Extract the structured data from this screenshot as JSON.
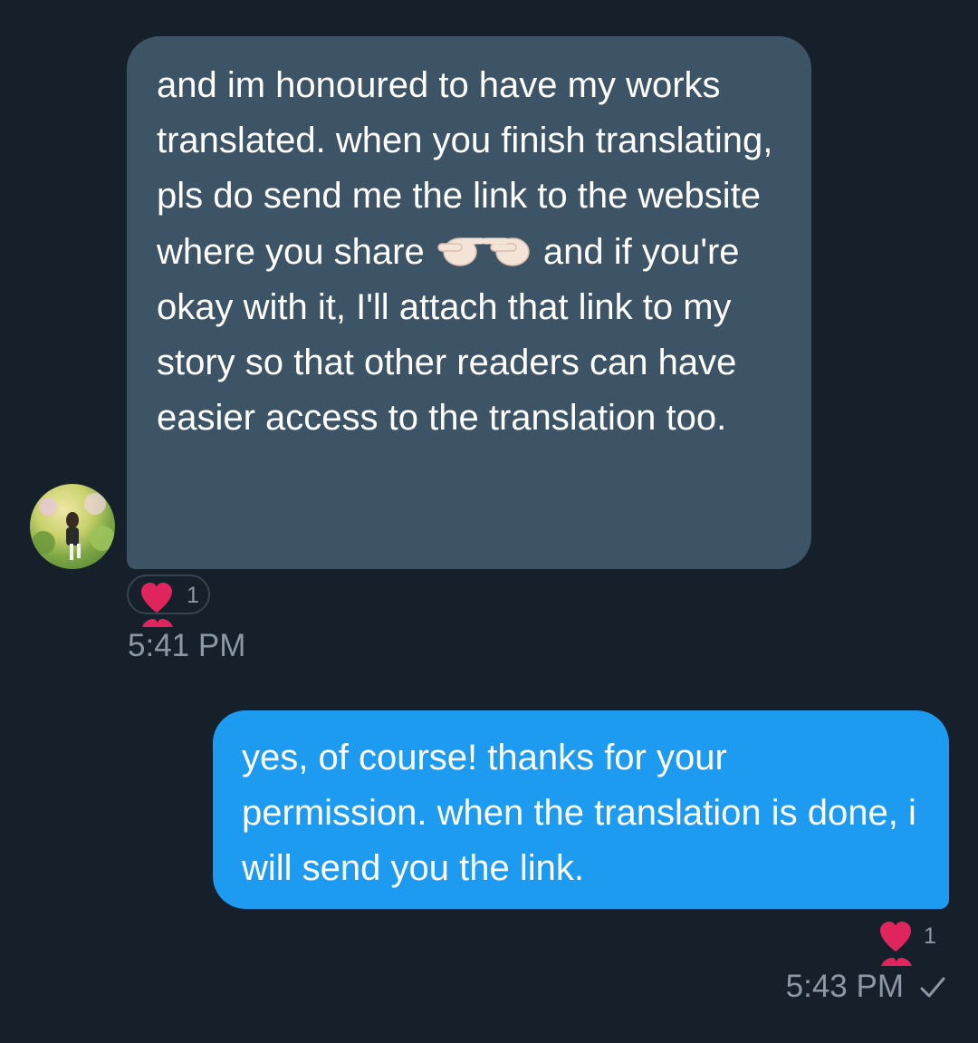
{
  "messages": {
    "incoming": {
      "text_before_emoji": "and im honoured to have my works translated. when you finish translating, pls do send me the link to the website where you share",
      "emoji": "👉👈",
      "text_after_emoji": "and if you're okay with it, I'll attach that link to my story so that other readers can have easier access to the translation too.",
      "reaction_count": "1",
      "timestamp": "5:41 PM"
    },
    "outgoing": {
      "text": "yes, of course! thanks for your permission. when the translation is done, i will send you the link.",
      "reaction_count": "1",
      "timestamp": "5:43 PM"
    }
  },
  "colors": {
    "background": "#15202b",
    "incoming_bubble": "#3d5466",
    "outgoing_bubble": "#1d9bf0",
    "heart": "#e0245e",
    "muted_text": "#8b98a5"
  },
  "icons": {
    "reaction": "heart-icon",
    "sent_status": "check-icon",
    "emoji": "pointing-fingers-emoji"
  }
}
